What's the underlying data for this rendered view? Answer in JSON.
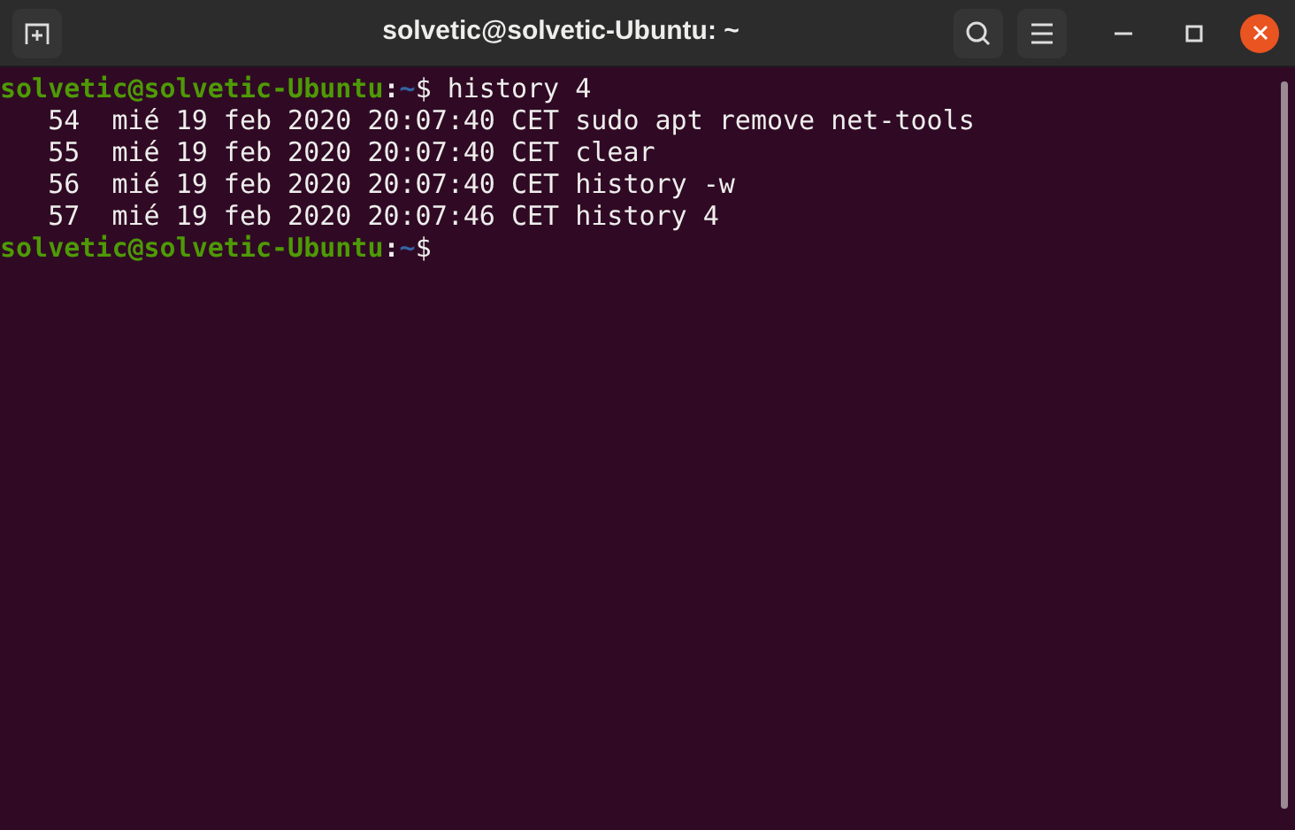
{
  "window": {
    "title": "solvetic@solvetic-Ubuntu: ~"
  },
  "terminal": {
    "lines": [
      {
        "kind": "prompt",
        "user_host": "solvetic@solvetic-Ubuntu",
        "separator": ":",
        "path": "~",
        "symbol": "$",
        "command": " history 4"
      },
      {
        "kind": "output",
        "text": "   54  mié 19 feb 2020 20:07:40 CET sudo apt remove net-tools"
      },
      {
        "kind": "output",
        "text": "   55  mié 19 feb 2020 20:07:40 CET clear"
      },
      {
        "kind": "output",
        "text": "   56  mié 19 feb 2020 20:07:40 CET history -w"
      },
      {
        "kind": "output",
        "text": "   57  mié 19 feb 2020 20:07:46 CET history 4"
      },
      {
        "kind": "prompt",
        "user_host": "solvetic@solvetic-Ubuntu",
        "separator": ":",
        "path": "~",
        "symbol": "$"
      }
    ]
  }
}
